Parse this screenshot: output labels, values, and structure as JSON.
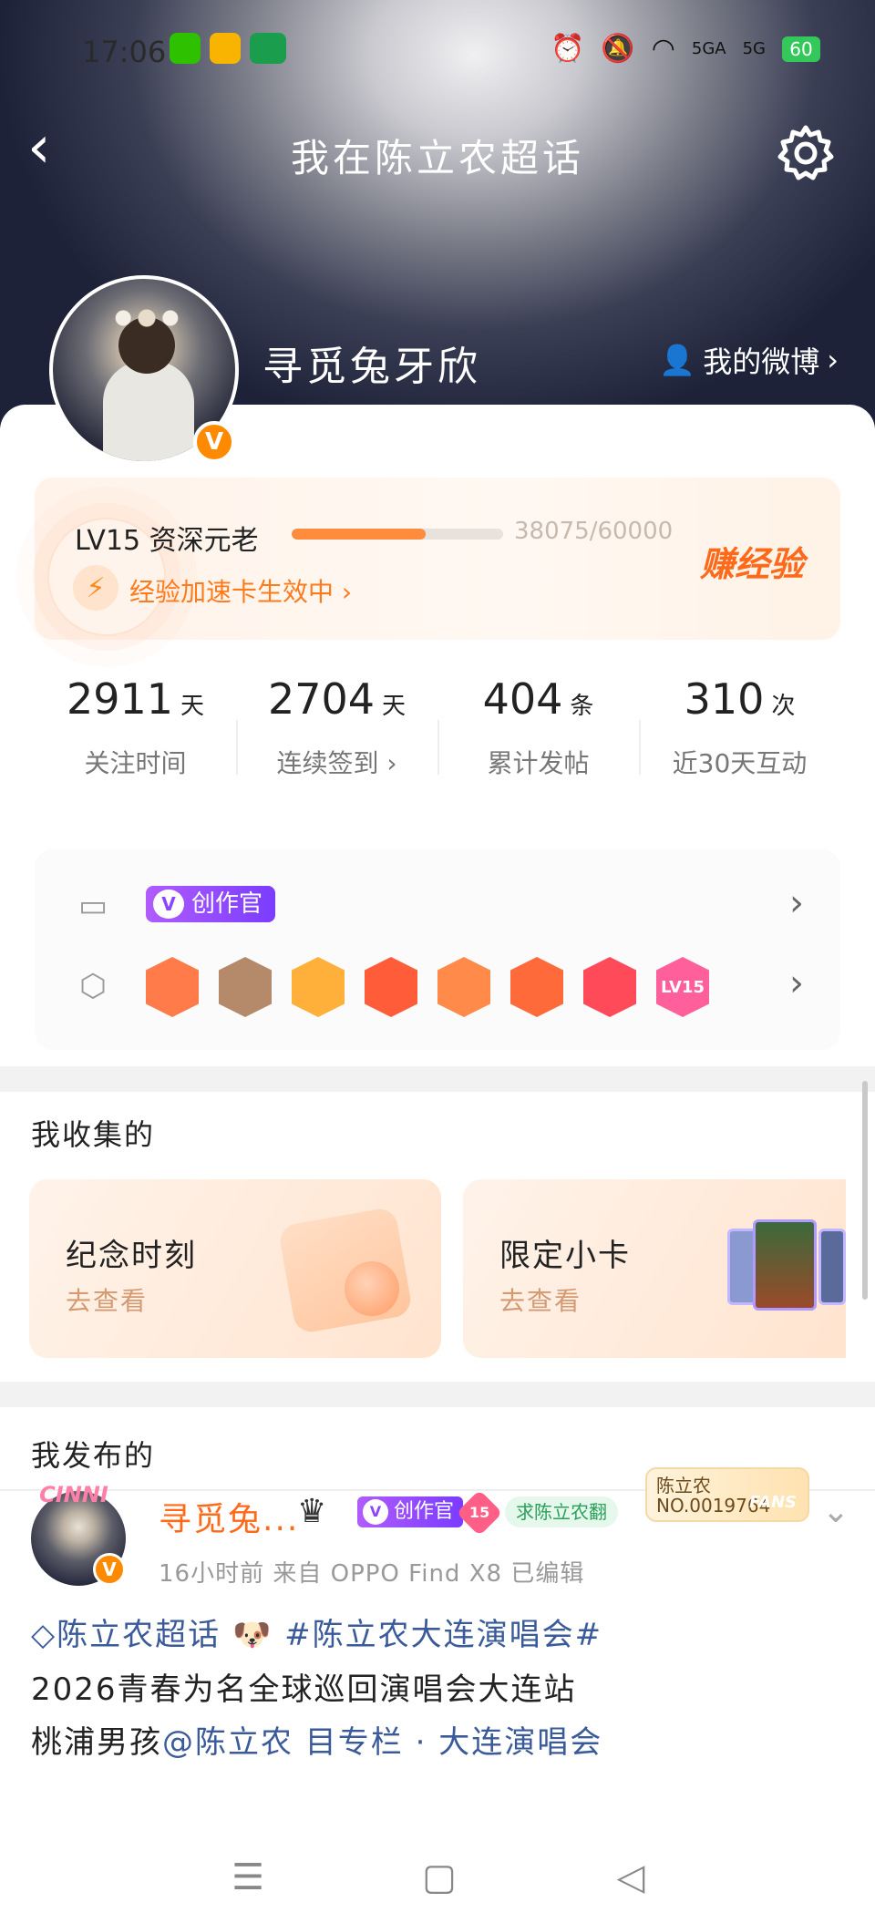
{
  "status_bar": {
    "time": "17:06",
    "apps": [
      {
        "name": "wechat-icon",
        "color": "#2dc100"
      },
      {
        "name": "weibo-icon",
        "color": "#f8b400"
      },
      {
        "name": "oppo-icon",
        "color": "#1a9d4c"
      }
    ],
    "signal_1": "5GA",
    "signal_2": "5G",
    "battery": "60"
  },
  "header": {
    "back_glyph": "‹",
    "title": "我在陈立农超话"
  },
  "profile": {
    "username": "寻觅兔牙欣",
    "verify_glyph": "V",
    "my_weibo_label": "我的微博",
    "arrow": "›"
  },
  "level": {
    "title": "LV15 资深元老",
    "exp": "38075/60000",
    "progress": 0.635,
    "boost": "经验加速卡生效中 ›",
    "earn_label": "赚经验"
  },
  "stats": [
    {
      "value": "2911",
      "unit": "天",
      "label": "关注时间"
    },
    {
      "value": "2704",
      "unit": "天",
      "label": "连续签到 ›"
    },
    {
      "value": "404",
      "unit": "条",
      "label": "累计发帖"
    },
    {
      "value": "310",
      "unit": "次",
      "label": "近30天互动"
    }
  ],
  "badges": {
    "creator_label": "创作官",
    "medals": [
      {
        "name": "medal-hand",
        "color": "#ff7b4a",
        "text": ""
      },
      {
        "name": "medal-cartoon-boy",
        "color": "#b58a6a",
        "text": ""
      },
      {
        "name": "medal-crown",
        "color": "#ffb03a",
        "text": ""
      },
      {
        "name": "medal-fox",
        "color": "#ff5d3a",
        "text": ""
      },
      {
        "name": "medal-bunny",
        "color": "#ff8a4a",
        "text": ""
      },
      {
        "name": "medal-tiger",
        "color": "#ff6a3a",
        "text": ""
      },
      {
        "name": "medal-rabbit",
        "color": "#ff4a5a",
        "text": ""
      },
      {
        "name": "medal-lv15",
        "color": "#ff5f9a",
        "text": "LV15"
      }
    ]
  },
  "collected": {
    "title": "我收集的",
    "cards": [
      {
        "title": "纪念时刻",
        "sub": "去查看"
      },
      {
        "title": "限定小卡",
        "sub": "去查看"
      }
    ]
  },
  "posted": {
    "title": "我发布的",
    "avatar_deco": "CINNI",
    "name": "寻觅兔...",
    "creator_label": "创作官",
    "lv_badge": "15",
    "fan_tag": "求陈立农翻",
    "fan_card_name": "陈立农",
    "fan_card_no": "NO.0019764",
    "fan_card_fans": "FANS",
    "meta": "16小时前  来自 OPPO Find X8  已编辑",
    "topic": "◇陈立农超话 🐶 #陈立农大连演唱会#",
    "line1": "2026青春为名全球巡回演唱会大连站",
    "line2_a": "桃浦男孩",
    "line2_b": "@陈立农",
    "line2_c": "  目专栏 · 大连演唱会"
  }
}
